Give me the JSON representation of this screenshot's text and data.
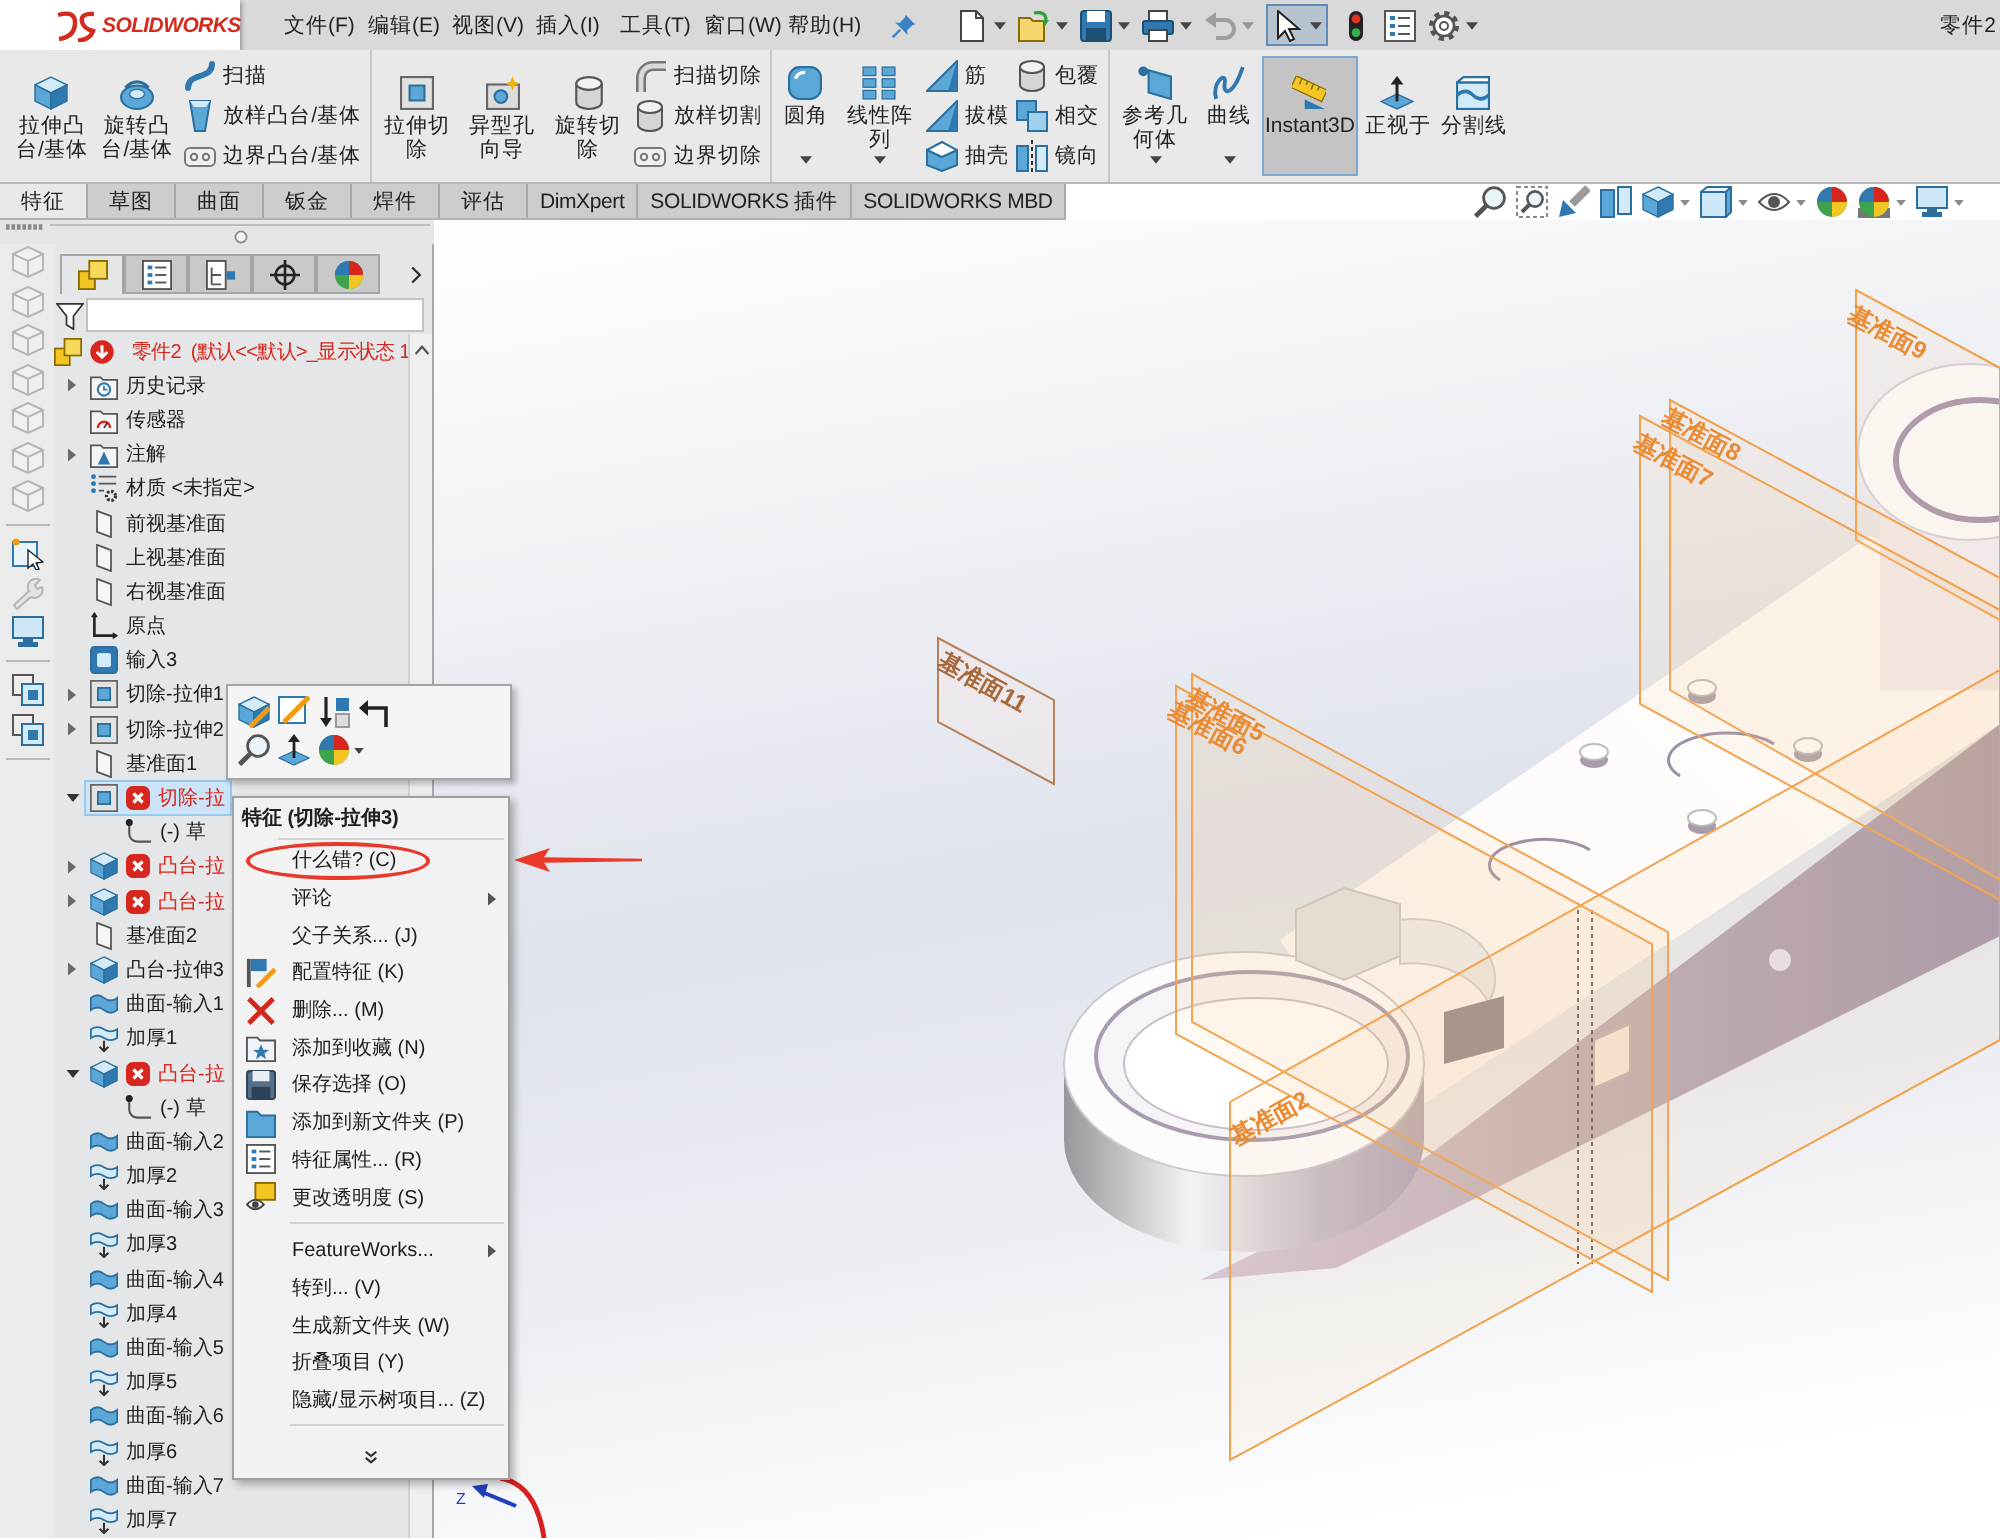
{
  "title_bar": {
    "logo_text": "SOLIDWORKS",
    "menus": [
      "文件(F)",
      "编辑(E)",
      "视图(V)",
      "插入(I)",
      "工具(T)",
      "窗口(W)",
      "帮助(H)"
    ],
    "document": "零件2"
  },
  "quick_access": [
    {
      "dropdown": true,
      "disabled": false,
      "pressed": false
    },
    {
      "dropdown": true,
      "disabled": false,
      "pressed": false
    },
    {
      "dropdown": true,
      "disabled": false,
      "pressed": false
    },
    {
      "dropdown": true,
      "disabled": false,
      "pressed": false
    },
    {
      "dropdown": true,
      "disabled": true,
      "pressed": false
    },
    {
      "dropdown": true,
      "disabled": false,
      "pressed": true
    },
    {
      "dropdown": false,
      "disabled": false,
      "pressed": false
    },
    {
      "dropdown": false,
      "disabled": false,
      "pressed": false
    },
    {
      "dropdown": true,
      "disabled": false,
      "pressed": false
    }
  ],
  "ribbon": [
    {
      "columns": [
        {
          "kind": "large",
          "label": "拉伸凸台/基体",
          "dropdown": false,
          "pressed": false
        },
        {
          "kind": "large",
          "label": "旋转凸台/基体",
          "dropdown": false,
          "pressed": false
        },
        {
          "kind": "stack",
          "items": [
            "扫描",
            "放样凸台/基体",
            "边界凸台/基体"
          ]
        }
      ]
    },
    {
      "columns": [
        {
          "kind": "large",
          "label": "拉伸切除",
          "dropdown": false,
          "pressed": false
        },
        {
          "kind": "large",
          "label": "异型孔向导",
          "dropdown": false,
          "pressed": false
        },
        {
          "kind": "large",
          "label": "旋转切除",
          "dropdown": false,
          "pressed": false
        },
        {
          "kind": "stack",
          "items": [
            "扫描切除",
            "放样切割",
            "边界切除"
          ]
        }
      ]
    },
    {
      "columns": [
        {
          "kind": "large",
          "label": "圆角",
          "dropdown": true,
          "pressed": false
        },
        {
          "kind": "large",
          "label": "线性阵列",
          "dropdown": true,
          "pressed": false
        },
        {
          "kind": "stack",
          "items": [
            "筋",
            "拔模",
            "抽壳"
          ]
        },
        {
          "kind": "stack",
          "items": [
            "包覆",
            "相交",
            "镜向"
          ]
        }
      ]
    },
    {
      "columns": [
        {
          "kind": "large",
          "label": "参考几何体",
          "dropdown": true,
          "pressed": false
        },
        {
          "kind": "large",
          "label": "曲线",
          "dropdown": true,
          "pressed": false
        },
        {
          "kind": "large",
          "label": "Instant3D",
          "dropdown": false,
          "pressed": true
        },
        {
          "kind": "large",
          "label": "正视于",
          "dropdown": false,
          "pressed": false
        },
        {
          "kind": "large",
          "label": "分割线",
          "dropdown": false,
          "pressed": false
        }
      ]
    }
  ],
  "command_tabs": [
    {
      "label": "特征",
      "selected": true
    },
    {
      "label": "草图",
      "selected": false
    },
    {
      "label": "曲面",
      "selected": false
    },
    {
      "label": "钣金",
      "selected": false
    },
    {
      "label": "焊件",
      "selected": false
    },
    {
      "label": "评估",
      "selected": false
    },
    {
      "label": "DimXpert",
      "selected": false
    },
    {
      "label": "SOLIDWORKS 插件",
      "selected": false
    },
    {
      "label": "SOLIDWORKS MBD",
      "selected": false
    }
  ],
  "view_toolbar": [
    {
      "dropdown": false
    },
    {
      "dropdown": false
    },
    {
      "dropdown": false
    },
    {
      "dropdown": false
    },
    {
      "dropdown": true
    },
    {
      "dropdown": true
    },
    {
      "dropdown": true
    },
    {
      "dropdown": false
    },
    {
      "dropdown": true
    },
    {
      "dropdown": true
    }
  ],
  "left_toolbar": [
    [
      {
        "disabled": true
      },
      {
        "disabled": true
      },
      {
        "disabled": true
      },
      {
        "disabled": true
      },
      {
        "disabled": true
      },
      {
        "disabled": true
      },
      {
        "disabled": true
      }
    ],
    [
      {
        "disabled": false
      },
      {
        "disabled": true
      },
      {
        "disabled": false
      }
    ],
    [
      {
        "disabled": false
      },
      {
        "disabled": false
      }
    ]
  ],
  "feature_manager": {
    "tabs": [
      {
        "selected": true
      },
      {
        "selected": false
      },
      {
        "selected": false
      },
      {
        "selected": false
      },
      {
        "selected": false
      }
    ],
    "root": {
      "label": "零件2  (默认<<默认>_显示状态 1",
      "error": true
    },
    "items": [
      {
        "kind": "history",
        "label": "历史记录",
        "expanded": false,
        "error": false,
        "selected": false
      },
      {
        "kind": "sensors",
        "label": "传感器",
        "error": false,
        "selected": false
      },
      {
        "kind": "annotations",
        "label": "注解",
        "expanded": false,
        "error": false,
        "selected": false
      },
      {
        "kind": "material",
        "label": "材质 <未指定>",
        "error": false,
        "selected": false
      },
      {
        "kind": "plane",
        "label": "前视基准面",
        "error": false,
        "selected": false
      },
      {
        "kind": "plane",
        "label": "上视基准面",
        "error": false,
        "selected": false
      },
      {
        "kind": "plane",
        "label": "右视基准面",
        "error": false,
        "selected": false
      },
      {
        "kind": "origin",
        "label": "原点",
        "error": false,
        "selected": false
      },
      {
        "kind": "import",
        "label": "输入3",
        "error": false,
        "selected": false
      },
      {
        "kind": "cut",
        "label": "切除-拉伸1",
        "expanded": false,
        "error": false,
        "selected": false
      },
      {
        "kind": "cut",
        "label": "切除-拉伸2",
        "expanded": false,
        "error": false,
        "selected": false
      },
      {
        "kind": "plane",
        "label": "基准面1",
        "error": false,
        "selected": false
      },
      {
        "kind": "cut",
        "label": "切除-拉",
        "expanded": true,
        "error": true,
        "selected": true,
        "children": [
          {
            "kind": "sketch",
            "label": "(-) 草",
            "error": false,
            "selected": false
          }
        ]
      },
      {
        "kind": "boss",
        "label": "凸台-拉",
        "expanded": false,
        "error": true,
        "selected": false
      },
      {
        "kind": "boss",
        "label": "凸台-拉",
        "expanded": false,
        "error": true,
        "selected": false
      },
      {
        "kind": "plane",
        "label": "基准面2",
        "error": false,
        "selected": false
      },
      {
        "kind": "boss",
        "label": "凸台-拉伸3",
        "expanded": false,
        "error": false,
        "selected": false
      },
      {
        "kind": "surface",
        "label": "曲面-输入1",
        "error": false,
        "selected": false
      },
      {
        "kind": "thicken",
        "label": "加厚1",
        "error": false,
        "selected": false
      },
      {
        "kind": "boss",
        "label": "凸台-拉",
        "expanded": true,
        "error": true,
        "selected": false,
        "children": [
          {
            "kind": "sketch",
            "label": "(-) 草",
            "error": false,
            "selected": false
          }
        ]
      },
      {
        "kind": "surface",
        "label": "曲面-输入2",
        "error": false,
        "selected": false
      },
      {
        "kind": "thicken",
        "label": "加厚2",
        "error": false,
        "selected": false
      },
      {
        "kind": "surface",
        "label": "曲面-输入3",
        "error": false,
        "selected": false
      },
      {
        "kind": "thicken",
        "label": "加厚3",
        "error": false,
        "selected": false
      },
      {
        "kind": "surface",
        "label": "曲面-输入4",
        "error": false,
        "selected": false
      },
      {
        "kind": "thicken",
        "label": "加厚4",
        "error": false,
        "selected": false
      },
      {
        "kind": "surface",
        "label": "曲面-输入5",
        "error": false,
        "selected": false
      },
      {
        "kind": "thicken",
        "label": "加厚5",
        "error": false,
        "selected": false
      },
      {
        "kind": "surface",
        "label": "曲面-输入6",
        "error": false,
        "selected": false
      },
      {
        "kind": "thicken",
        "label": "加厚6",
        "error": false,
        "selected": false
      },
      {
        "kind": "surface",
        "label": "曲面-输入7",
        "error": false,
        "selected": false
      },
      {
        "kind": "thicken",
        "label": "加厚7",
        "error": false,
        "selected": false
      }
    ]
  },
  "viewport": {
    "planes": [
      {
        "label": "基准面9"
      },
      {
        "label": "基准面8"
      },
      {
        "label": "基准面7"
      },
      {
        "label": "基准面11"
      },
      {
        "label": "基准面5"
      },
      {
        "label": "基准面6"
      },
      {
        "label": "基准面2"
      }
    ],
    "triad_label": "Z"
  },
  "context_toolbar": [
    {
      "dropdown": false
    },
    {
      "dropdown": false
    },
    {
      "dropdown": false
    },
    {
      "dropdown": false
    },
    {
      "dropdown": false
    },
    {
      "dropdown": false
    },
    {
      "dropdown": true
    }
  ],
  "context_menu": {
    "title": "特征 (切除-拉伸3)",
    "sections": [
      [
        {
          "label": "什么错? (C)",
          "submenu": false,
          "highlighted": true
        },
        {
          "label": "评论",
          "submenu": true,
          "highlighted": false
        },
        {
          "label": "父子关系... (J)",
          "submenu": false,
          "highlighted": false
        },
        {
          "label": "配置特征 (K)",
          "submenu": false,
          "highlighted": false
        },
        {
          "label": "删除... (M)",
          "submenu": false,
          "highlighted": false
        },
        {
          "label": "添加到收藏 (N)",
          "submenu": false,
          "highlighted": false
        },
        {
          "label": "保存选择 (O)",
          "submenu": false,
          "highlighted": false
        },
        {
          "label": "添加到新文件夹 (P)",
          "submenu": false,
          "highlighted": false
        },
        {
          "label": "特征属性... (R)",
          "submenu": false,
          "highlighted": false
        },
        {
          "label": "更改透明度 (S)",
          "submenu": false,
          "highlighted": false
        }
      ],
      [
        {
          "label": "FeatureWorks...",
          "submenu": true,
          "highlighted": false
        },
        {
          "label": "转到... (V)",
          "submenu": false,
          "highlighted": false
        },
        {
          "label": "生成新文件夹 (W)",
          "submenu": false,
          "highlighted": false
        },
        {
          "label": "折叠项目 (Y)",
          "submenu": false,
          "highlighted": false
        },
        {
          "label": "隐藏/显示树项目... (Z)",
          "submenu": false,
          "highlighted": false
        }
      ]
    ],
    "more": true
  }
}
